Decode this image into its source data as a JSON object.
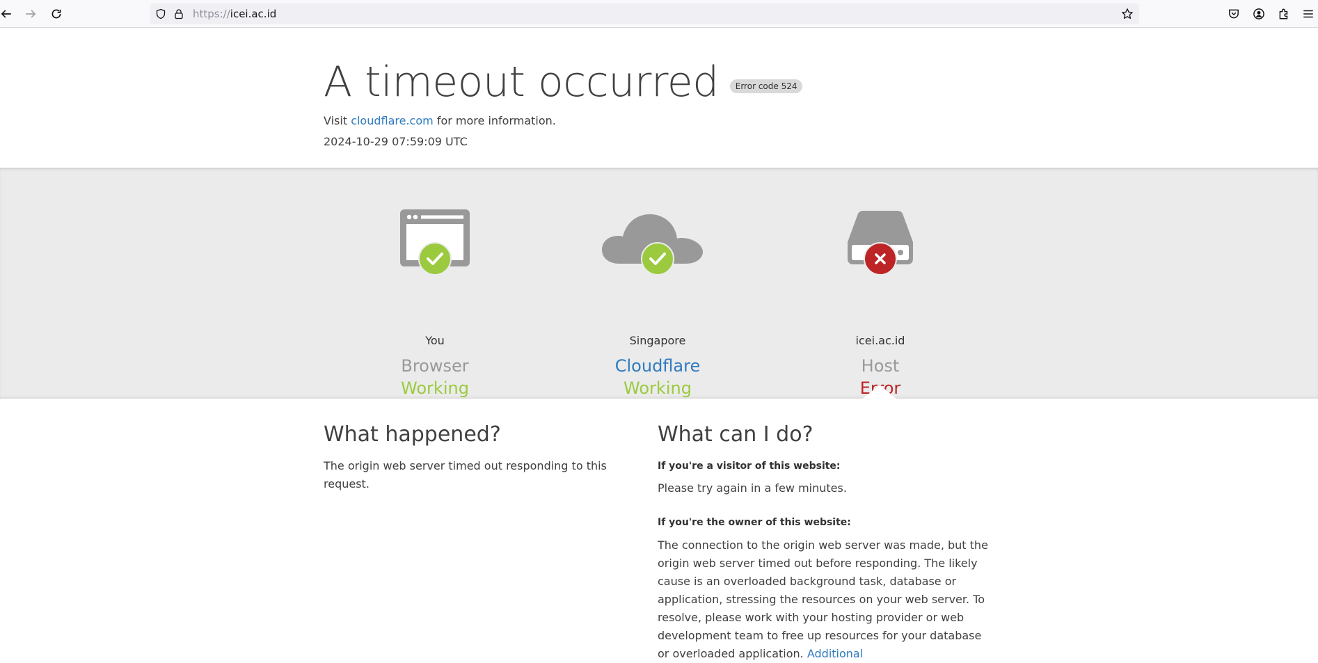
{
  "browser": {
    "url_protocol": "https://",
    "url_host": "icei.ac.id",
    "icons": {
      "back": "back-arrow-icon",
      "forward": "forward-arrow-icon",
      "reload": "reload-icon",
      "shield": "shield-icon",
      "lock": "lock-icon",
      "bookmark": "star-icon",
      "pocket": "pocket-icon",
      "account": "account-icon",
      "extensions": "extensions-icon",
      "menu": "hamburger-menu-icon"
    }
  },
  "header": {
    "title": "A timeout occurred",
    "error_badge": "Error code 524",
    "visit_prefix": "Visit",
    "visit_link": "cloudflare.com",
    "visit_suffix": "for more information.",
    "timestamp": "2024-10-29 07:59:09 UTC"
  },
  "status": {
    "browser": {
      "location": "You",
      "name": "Browser",
      "status": "Working"
    },
    "cloudflare": {
      "location": "Singapore",
      "name": "Cloudflare",
      "status": "Working"
    },
    "host": {
      "location": "icei.ac.id",
      "name": "Host",
      "status": "Error"
    }
  },
  "colors": {
    "ok": "#9bca3e",
    "error": "#bd2426",
    "link": "#2f7bbf",
    "band": "#ebebeb"
  },
  "what_happened": {
    "heading": "What happened?",
    "text": "The origin web server timed out responding to this request."
  },
  "what_can_i_do": {
    "heading": "What can I do?",
    "visitor_label": "If you're a visitor of this website:",
    "visitor_text": "Please try again in a few minutes.",
    "owner_label": "If you're the owner of this website:",
    "owner_text": "The connection to the origin web server was made, but the origin web server timed out before responding. The likely cause is an overloaded background task, database or application, stressing the resources on your web server. To resolve, please work with your hosting provider or web development team to free up resources for your database or overloaded application.",
    "owner_link": "Additional"
  }
}
